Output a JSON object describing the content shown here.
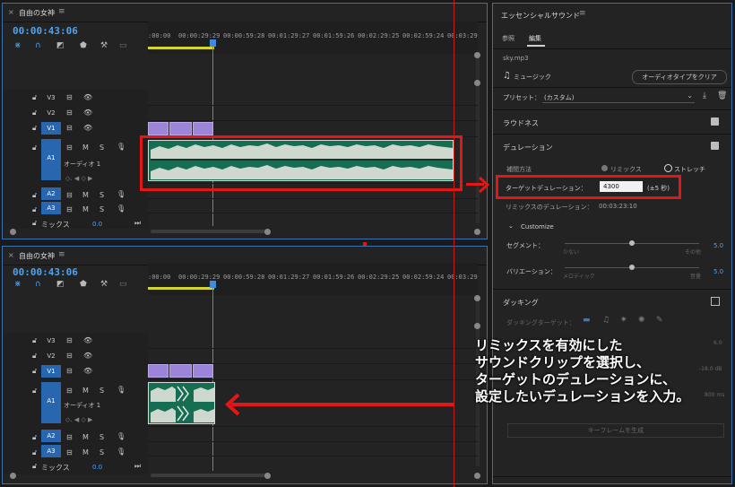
{
  "timeline_top": {
    "title": "自由の女神",
    "timecode": "00:00:43:06",
    "ruler_ticks": [
      ":00:00",
      "00:00:29:29",
      "00:00:59:28",
      "00:01:29:27",
      "00:01:59:26",
      "00:02:29:25",
      "00:02:59:24",
      "00:03:29"
    ],
    "video_tracks": [
      "V3",
      "V2",
      "V1"
    ],
    "audio_tracks": [
      "A1",
      "A2",
      "A3"
    ],
    "audio_track_label": "オーディオ 1",
    "mix_label": "ミックス",
    "mix_value": "0.0",
    "track_buttons": {
      "m": "M",
      "s": "S"
    }
  },
  "timeline_bottom": {
    "title": "自由の女神",
    "timecode": "00:00:43:06",
    "ruler_ticks": [
      ":00:00",
      "00:00:29:29",
      "00:00:59:28",
      "00:01:29:27",
      "00:01:59:26",
      "00:02:29:25",
      "00:02:59:24",
      "00:03:29"
    ],
    "video_tracks": [
      "V3",
      "V2",
      "V1"
    ],
    "audio_tracks": [
      "A1",
      "A2",
      "A3"
    ],
    "audio_track_label": "オーディオ 1",
    "mix_label": "ミックス",
    "mix_value": "0.0",
    "track_buttons": {
      "m": "M",
      "s": "S"
    }
  },
  "essential_sound": {
    "title": "エッセンシャルサウンド",
    "tabs": [
      "参照",
      "編集"
    ],
    "clip_name": "sky.mp3",
    "type_label": "ミュージック",
    "clear_button": "オーディオタイプをクリア",
    "preset_label": "プリセット：",
    "preset_value": "(カスタム)",
    "loudness": "ラウドネス",
    "duration": "デュレーション",
    "method_label": "補間方法",
    "method_remix": "リミックス",
    "method_stretch": "ストレッチ",
    "target_label": "ターゲットデュレーション：",
    "target_value": "4300",
    "target_tolerance": "(±5 秒)",
    "remix_duration_label": "リミックスのデュレーション：",
    "remix_duration_value": "00:03:23:10",
    "customize": "Customize",
    "segment_label": "セグメント：",
    "segment_min": "少ない",
    "segment_max": "その他",
    "segment_value": "5.0",
    "variation_label": "バリエーション：",
    "variation_min": "メロディック",
    "variation_max": "音量",
    "variation_value": "5.0",
    "ducking": "ダッキング",
    "ducking_target": "ダッキングターゲット：",
    "value_6": "6.0",
    "value_db": "-18.0 dB",
    "value_ms": "800 ms",
    "keyframe_button": "キーフレームを生成"
  },
  "caption": {
    "line1": "リミックスを有効にした",
    "line2": "サウンドクリップを選択し、",
    "line3": "ターゲットのデュレーションに、",
    "line4": "設定したいデュレーションを入力。"
  },
  "colors": {
    "accent": "#4ea3f0",
    "highlight": "#e51616",
    "clip_video": "#9c84d8",
    "clip_audio": "#156d52"
  }
}
